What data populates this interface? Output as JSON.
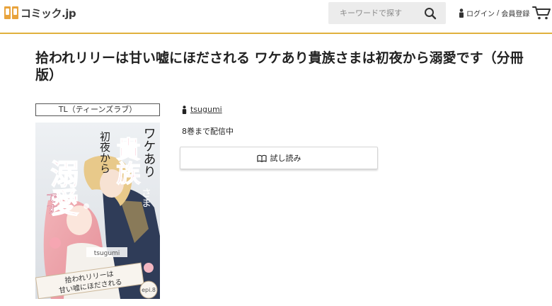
{
  "header": {
    "logo_text": "コミック.jp",
    "search_placeholder": "キーワードで探す",
    "login_label": "ログイン",
    "separator": "/",
    "register_label": "会員登録"
  },
  "product": {
    "title": "拾われリリーは甘い嘘にほだされる ワケあり貴族さまは初夜から溺愛です（分冊版）",
    "genre": "TL（ティーンズラブ）",
    "author": "tsugumi",
    "volumes_text": "8巻まで配信中",
    "trial_label": "試し読み"
  },
  "cover": {
    "title_main": "溺愛",
    "title_top": "ワケあり",
    "title_side": "貴族",
    "title_small": "初夜から",
    "title_sama": "さま",
    "title_desu": "です",
    "banner_line1": "拾われリリーは",
    "banner_line2": "甘い嘘にほだされる",
    "author_badge": "tsugumi",
    "ep_label": "epi.8"
  },
  "colors": {
    "accent": "#e0b13d",
    "logo": "#e8a33c"
  }
}
